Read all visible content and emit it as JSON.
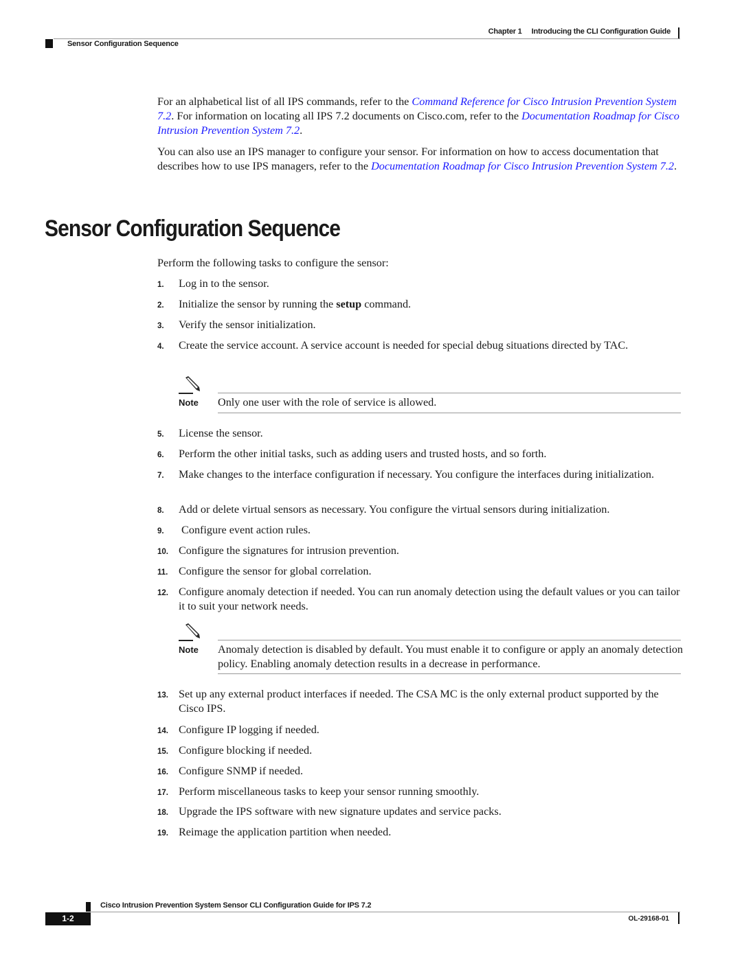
{
  "header": {
    "chapter": "Chapter 1",
    "chapter_title": "Introducing the CLI Configuration Guide",
    "section": "Sensor Configuration Sequence"
  },
  "intro": {
    "p1": {
      "t1": "For an alphabetical list of all IPS commands, refer to the ",
      "link1": "Command Reference for Cisco Intrusion Prevention System 7.2",
      "t2": ". For information on locating all IPS 7.2 documents on Cisco.com, refer to the ",
      "link2": "Documentation Roadmap for Cisco Intrusion Prevention System 7.2",
      "t3": "."
    },
    "p2": {
      "t1": "You can also use an IPS manager to configure your sensor. For information on how to access documentation that describes how to use IPS managers, refer to the ",
      "link1": "Documentation Roadmap for Cisco Intrusion Prevention System 7.2",
      "t2": "."
    }
  },
  "section": {
    "title": "Sensor Configuration Sequence",
    "lead": "Perform the following tasks to configure the sensor:",
    "steps": [
      {
        "num": "1.",
        "text": "Log in to the sensor."
      },
      {
        "num": "2.",
        "pre": "Initialize the sensor by running the ",
        "bold": "setup",
        "post": " command."
      },
      {
        "num": "3.",
        "text": "Verify the sensor initialization."
      },
      {
        "num": "4.",
        "text": "Create the service account. A service account is needed for special debug situations directed by TAC."
      },
      {
        "num": "5.",
        "text": "License the sensor."
      },
      {
        "num": "6.",
        "text": "Perform the other initial tasks, such as adding users and trusted hosts, and so forth."
      },
      {
        "num": "7.",
        "text": "Make changes to the interface configuration if necessary. You configure the interfaces during initialization."
      },
      {
        "num": "8.",
        "text": "Add or delete virtual sensors as necessary. You configure the virtual sensors during initialization."
      },
      {
        "num": "9.",
        "text": " Configure event action rules."
      },
      {
        "num": "10.",
        "text": "Configure the signatures for intrusion prevention."
      },
      {
        "num": "11.",
        "text": "Configure the sensor for global correlation."
      },
      {
        "num": "12.",
        "text": "Configure anomaly detection if needed. You can run anomaly detection using the default values or you can tailor it to suit your network needs."
      },
      {
        "num": "13.",
        "text": "Set up any external product interfaces if needed. The CSA MC is the only external product supported by the Cisco IPS."
      },
      {
        "num": "14.",
        "text": "Configure IP logging if needed."
      },
      {
        "num": "15.",
        "text": "Configure blocking if needed."
      },
      {
        "num": "16.",
        "text": "Configure SNMP if needed."
      },
      {
        "num": "17.",
        "text": "Perform miscellaneous tasks to keep your sensor running smoothly."
      },
      {
        "num": "18.",
        "text": "Upgrade the IPS software with new signature updates and service packs."
      },
      {
        "num": "19.",
        "text": "Reimage the application partition when needed."
      }
    ],
    "notes": [
      {
        "label": "Note",
        "text": "Only one user with the role of service is allowed."
      },
      {
        "label": "Note",
        "text": "Anomaly detection is disabled by default. You must enable it to configure or apply an anomaly detection policy. Enabling anomaly detection results in a decrease in performance."
      }
    ]
  },
  "footer": {
    "title": "Cisco Intrusion Prevention System Sensor CLI Configuration Guide for IPS 7.2",
    "page": "1-2",
    "doc_id": "OL-29168-01"
  },
  "colors": {
    "link": "#1a1aff",
    "text": "#1a1a1a",
    "rule": "#999999"
  }
}
